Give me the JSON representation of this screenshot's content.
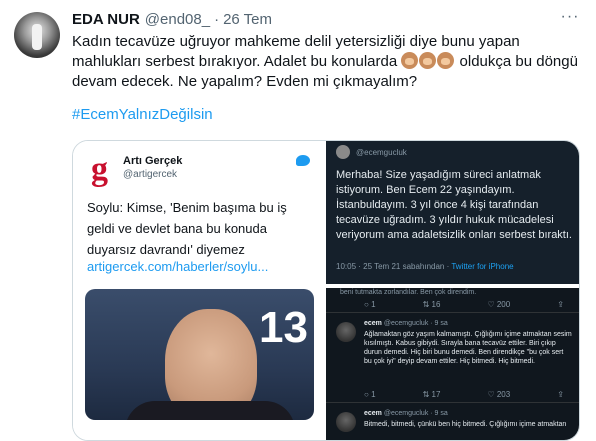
{
  "tweet": {
    "author_name": "EDA NUR",
    "author_handle": "@end08_",
    "separator": "·",
    "date": "26 Tem",
    "more_label": "···",
    "text_part1": "Kadın tecavüze uğruyor mahkeme delil yetersizliği diye bunu yapan mahlukları serbest bırakıyor. Adalet bu konularda ",
    "text_part2": " oldukça bu döngü devam edecek. Ne yapalım? Evden mi çıkmayalım?",
    "hashtag": "#EcemYalnızDeğilsin",
    "emoji_name": "see-no-evil-monkey-emoji"
  },
  "card_left": {
    "logo_letter": "g",
    "source_name": "Artı Gerçek",
    "source_handle": "@artigercek",
    "text": "Soylu: Kimse, 'Benim başıma bu iş geldi ve devlet bana bu konuda duyarsız davrandı' diyemez",
    "link": "artigercek.com/haberler/soylu...",
    "photo_number": "13"
  },
  "card_right_top": {
    "handle": "@ecemgucluk",
    "text": "Merhaba! Size yaşadığım süreci anlatmak istiyorum. Ben Ecem 22 yaşındayım. İstanbuldayım. 3 yıl önce 4 kişi tarafından tecavüze uğradım. 3 yıldır hukuk mücadelesi veriyorum ama adaletsizlik onları serbest bıraktı.",
    "meta_time": "10:05 · 25 Tem 21 sabahından · ",
    "meta_source": "Twitter for iPhone"
  },
  "card_right_bottom": {
    "top_fragment": "beni tutmakta zorlandılar. Ben çok direndim.",
    "row1": {
      "reply": "1",
      "retweet": "16",
      "like": "200"
    },
    "reply1": {
      "name": "ecem",
      "handle": "@ecemgucluk · 9 sa",
      "text": "Ağlamaktan göz yaşım kalmamıştı. Çığlığımı içime atmaktan sesim kısılmıştı. Kabus gibiydi. Sırayla bana tecavüz ettiler. Biri çıkıp durun demedi. Hiç biri bunu demedi. Ben direndikçe \"bu çok sert bu çok iyi\" deyip devam ettiler. Hiç bitmedi. Hiç bitmedi."
    },
    "row2": {
      "reply": "1",
      "retweet": "17",
      "like": "203"
    },
    "reply2": {
      "name": "ecem",
      "handle": "@ecemgucluk · 9 sa",
      "text": "Bitmedi, bitmedi, çünkü ben hiç bitmedi. Çığlığımı içime atmaktan"
    }
  },
  "colors": {
    "link": "#1d9bf0",
    "secondary_text": "#536471",
    "brand_red": "#c8102e",
    "dark_bg": "#15202b"
  }
}
